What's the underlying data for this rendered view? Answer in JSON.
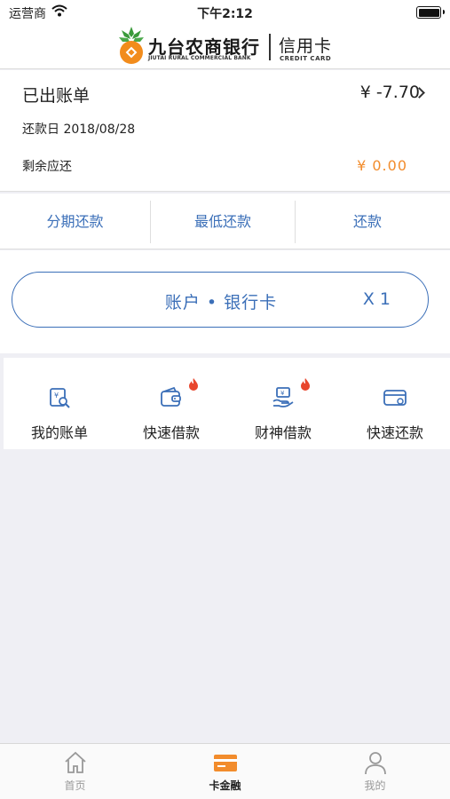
{
  "status_bar": {
    "carrier": "运营商",
    "time": "下午2:12",
    "battery_level": 1.0
  },
  "header": {
    "bank_name": "九台农商银行",
    "bank_name_en": "JIUTAI RURAL COMMERCIAL BANK",
    "card_type": "信用卡",
    "card_type_en": "CREDIT CARD"
  },
  "bill": {
    "title": "已出账单",
    "amount": "¥ -7.70",
    "due_date": "还款日 2018/08/28",
    "remaining_label": "剩余应还",
    "remaining_value": "¥ 0.00"
  },
  "actions": [
    {
      "label": "分期还款"
    },
    {
      "label": "最低还款"
    },
    {
      "label": "还款"
    }
  ],
  "account": {
    "label": "账户 • 银行卡",
    "count": "X 1"
  },
  "quick_links": [
    {
      "label": "我的账单",
      "icon": "bill-search-icon",
      "hot": false
    },
    {
      "label": "快速借款",
      "icon": "wallet-icon",
      "hot": true
    },
    {
      "label": "财神借款",
      "icon": "hand-money-icon",
      "hot": true
    },
    {
      "label": "快速还款",
      "icon": "card-repay-icon",
      "hot": false
    }
  ],
  "tabs": [
    {
      "label": "首页",
      "icon": "home-icon",
      "active": false
    },
    {
      "label": "卡金融",
      "icon": "card-icon",
      "active": true
    },
    {
      "label": "我的",
      "icon": "user-icon",
      "active": false
    }
  ],
  "colors": {
    "accent": "#3b6fb8",
    "highlight": "#f28c2c",
    "tab_active": "#f28c2c"
  }
}
